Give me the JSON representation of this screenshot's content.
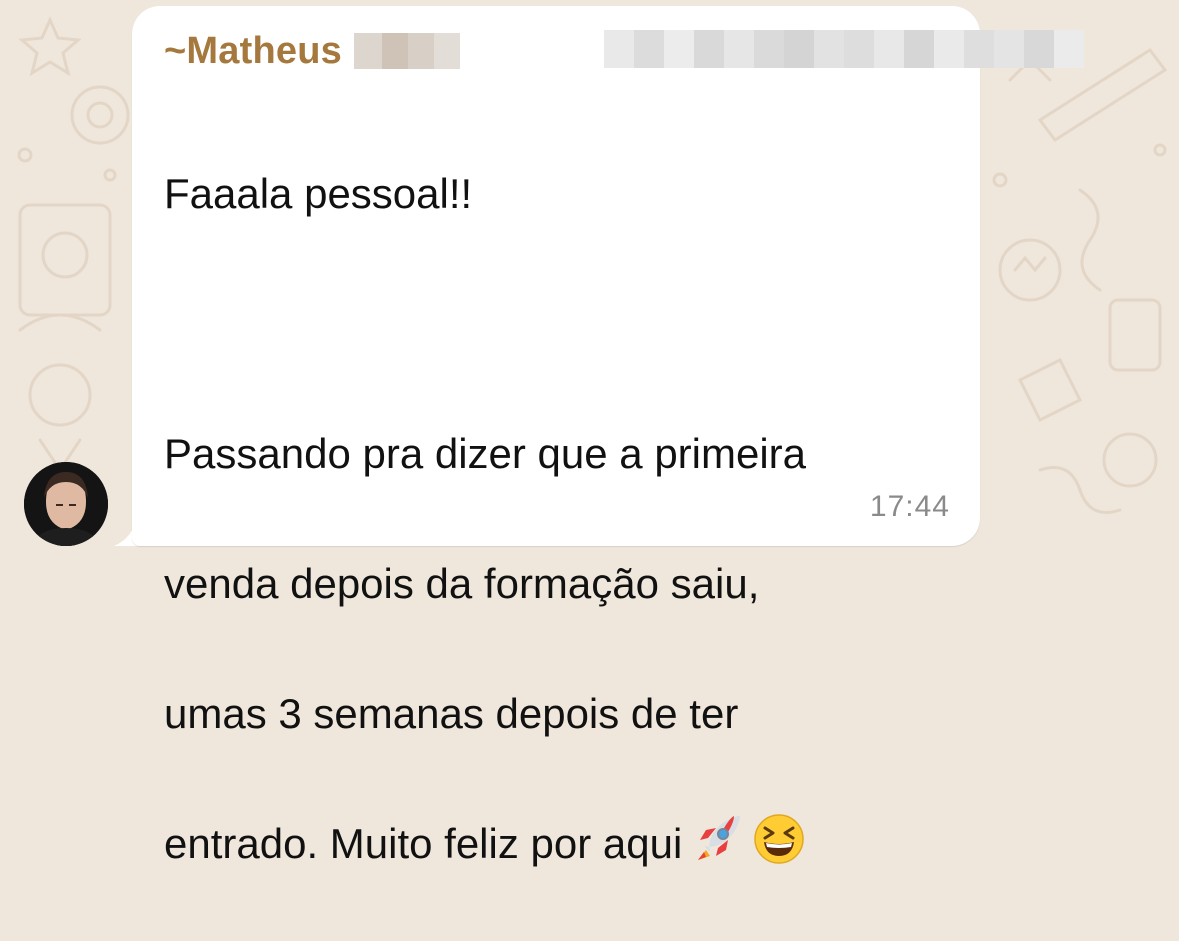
{
  "chat": {
    "sender_prefix": "~",
    "sender_name": "Matheus",
    "message_lines": [
      "Faaala pessoal!!",
      "",
      "Passando pra dizer que a primeira",
      "venda depois da formação saiu,",
      "umas 3 semanas depois de ter",
      "entrado. Muito feliz por aqui"
    ],
    "timestamp": "17:44",
    "emojis": [
      "rocket-emoji",
      "laughing-face-emoji"
    ]
  },
  "colors": {
    "wallpaper": "#efe7dc",
    "bubble": "#ffffff",
    "sender_name": "#a5783d",
    "message_text": "#111111",
    "timestamp": "#8a8a8a"
  }
}
